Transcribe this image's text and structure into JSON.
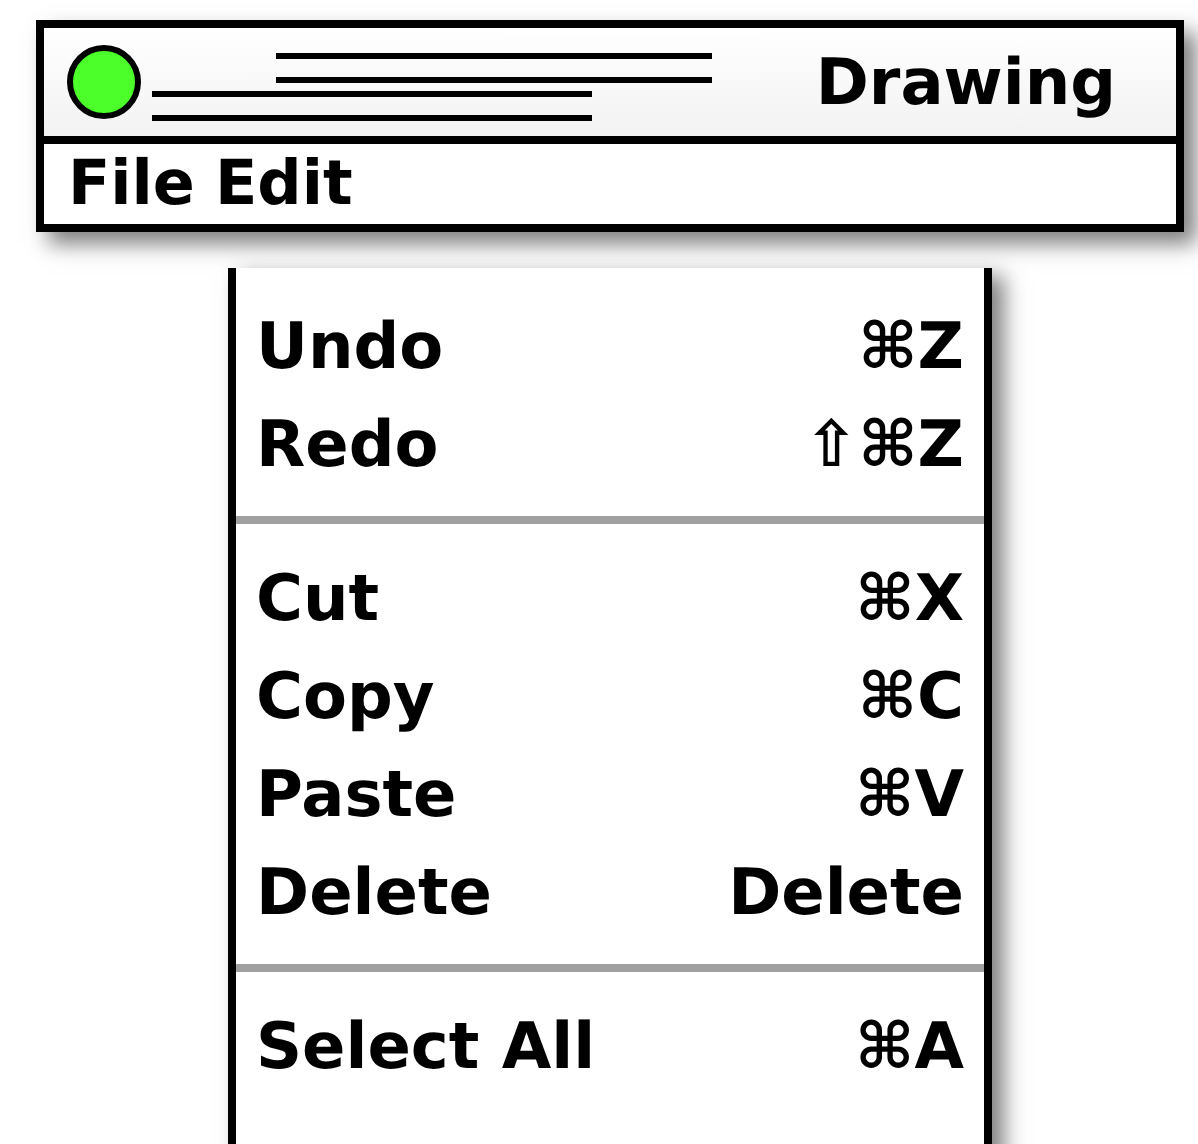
{
  "window": {
    "title": "Drawing"
  },
  "menubar": {
    "items": [
      {
        "label": "File"
      },
      {
        "label": "Edit"
      }
    ]
  },
  "menu": {
    "groups": [
      {
        "items": [
          {
            "label": "Undo",
            "shortcut": "⌘Z"
          },
          {
            "label": "Redo",
            "shortcut": "⇧⌘Z"
          }
        ]
      },
      {
        "items": [
          {
            "label": "Cut",
            "shortcut": "⌘X"
          },
          {
            "label": "Copy",
            "shortcut": "⌘C"
          },
          {
            "label": "Paste",
            "shortcut": "⌘V"
          },
          {
            "label": "Delete",
            "shortcut": "Delete"
          }
        ]
      },
      {
        "items": [
          {
            "label": "Select All",
            "shortcut": "⌘A"
          }
        ]
      }
    ]
  }
}
